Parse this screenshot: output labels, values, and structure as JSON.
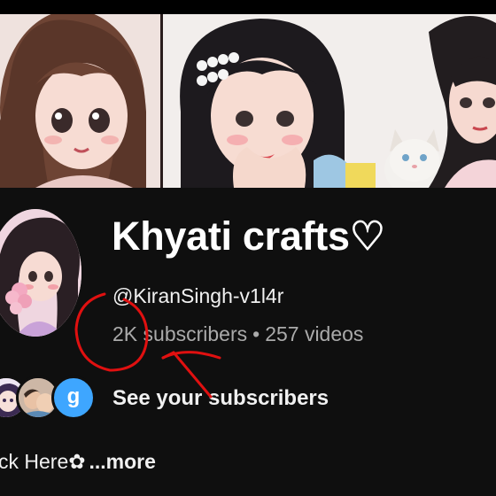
{
  "channel": {
    "name": "Khyati crafts♡",
    "handle": "@KiranSingh-v1l4r",
    "subscribers": "2K subscribers",
    "separator": "•",
    "videos": "257 videos"
  },
  "subscribers_row": {
    "third_avatar_letter": "g",
    "label": "See your subscribers"
  },
  "description": {
    "text": "ck Here✿",
    "more_label": "...more"
  },
  "colors": {
    "background": "#0f0f0f",
    "annotation": "#e01010",
    "muted_text": "#aaaaaa",
    "avatar_blue": "#3ea6ff"
  }
}
